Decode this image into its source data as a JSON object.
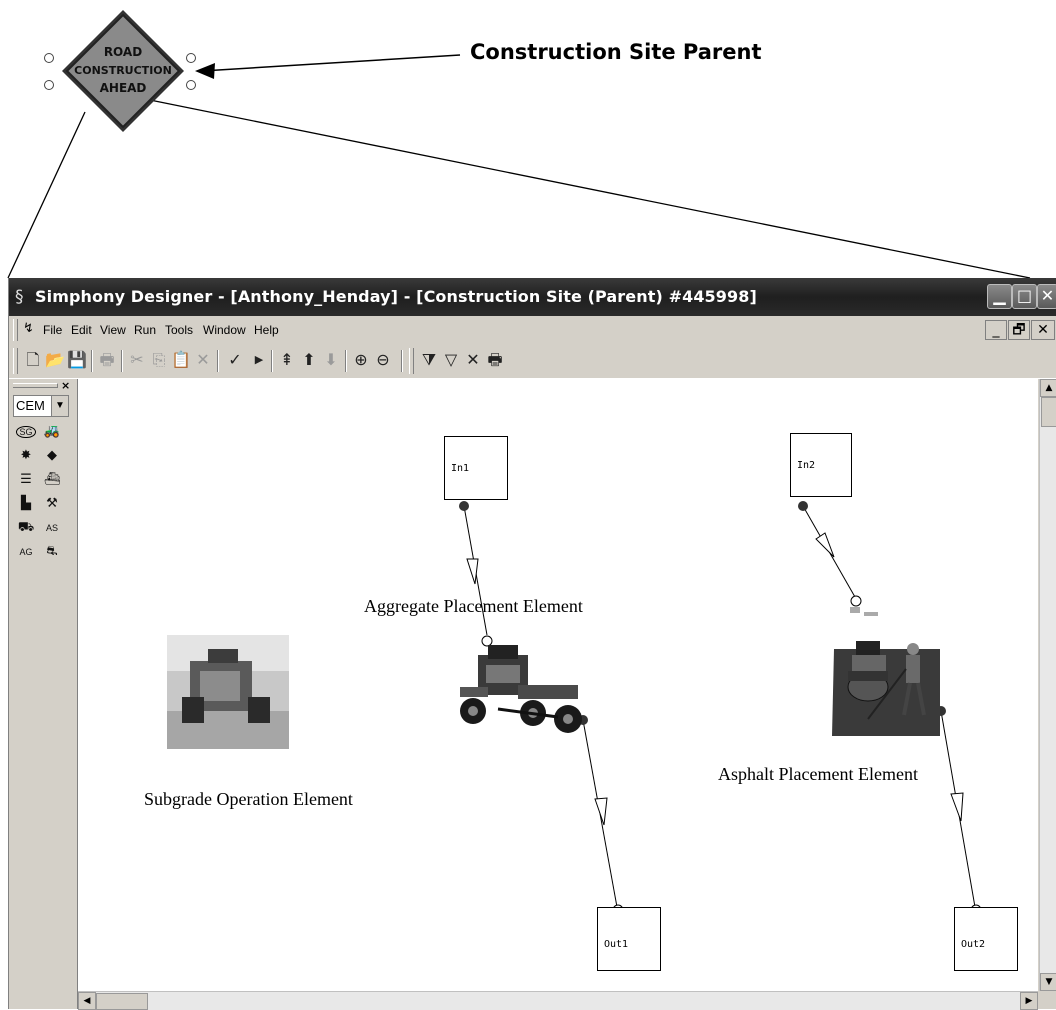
{
  "annotation": {
    "sign_lines": [
      "ROAD",
      "CONSTRUCTION",
      "AHEAD"
    ],
    "parent_label": "Construction Site Parent"
  },
  "window": {
    "title": "Simphony Designer - [Anthony_Henday] - [Construction Site (Parent) #445998]",
    "title_buttons": [
      "minimize",
      "maximize",
      "close"
    ]
  },
  "menubar": {
    "items": [
      "File",
      "Edit",
      "View",
      "Run",
      "Tools",
      "Window",
      "Help"
    ],
    "mdi_buttons": [
      "_",
      "🗗",
      "✕"
    ]
  },
  "toolbar": {
    "icons": [
      "new-icon",
      "open-icon",
      "save-icon",
      "print-icon",
      "cut-icon",
      "copy-icon",
      "paste-icon",
      "delete-icon",
      "check-icon",
      "run-icon",
      "up-top-icon",
      "up-icon",
      "down-icon",
      "zoom-in-icon",
      "zoom-out-icon",
      "filter-edit-icon",
      "filter-icon",
      "clear-icon",
      "print-trace-icon"
    ]
  },
  "palette": {
    "selected_template": "CEM",
    "items": [
      "SG",
      "loader",
      "spreader",
      "diamond",
      "layers",
      "paver",
      "dozer",
      "grader",
      "truck",
      "AS",
      "AG",
      "tractor"
    ]
  },
  "canvas": {
    "ports": [
      {
        "id": "in1",
        "label": "In1"
      },
      {
        "id": "in2",
        "label": "In2"
      },
      {
        "id": "out1",
        "label": "Out1"
      },
      {
        "id": "out2",
        "label": "Out2"
      }
    ],
    "elements": {
      "aggregate": "Aggregate Placement Element",
      "subgrade": "Subgrade Operation Element",
      "asphalt": "Asphalt Placement Element"
    }
  }
}
